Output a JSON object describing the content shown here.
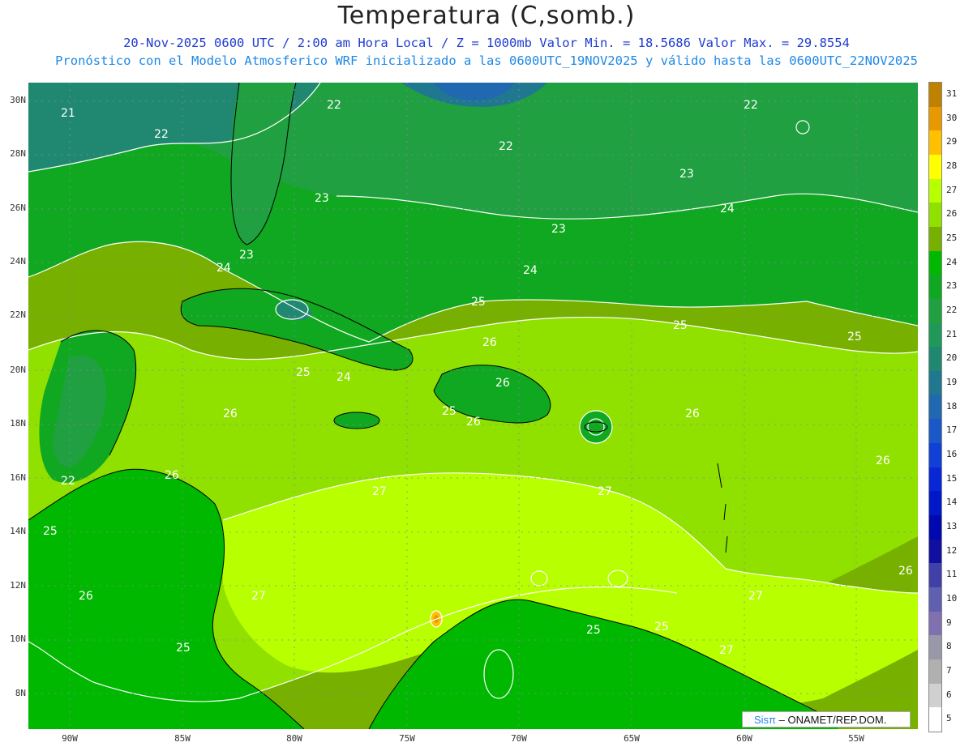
{
  "header": {
    "title": "Temperatura (C,somb.)",
    "line1": "20-Nov-2025  0600 UTC / 2:00 am Hora Local / Z = 1000mb   Valor Min. = 18.5686  Valor Max. = 29.8554",
    "line2": "Pronóstico con el Modelo Atmosferico WRF inicializado a las 0600UTC_19NOV2025 y válido hasta las  0600UTC_22NOV2025"
  },
  "axes": {
    "lat_labels": [
      "30N",
      "28N",
      "26N",
      "24N",
      "22N",
      "20N",
      "18N",
      "16N",
      "14N",
      "12N",
      "10N",
      "8N"
    ],
    "lon_labels": [
      "90W",
      "85W",
      "80W",
      "75W",
      "70W",
      "65W",
      "60W",
      "55W"
    ]
  },
  "contour_labels": [
    "21",
    "22",
    "22",
    "22",
    "22",
    "23",
    "23",
    "23",
    "23",
    "24",
    "24",
    "24",
    "24",
    "25",
    "25",
    "25",
    "25",
    "25",
    "25",
    "25",
    "25",
    "26",
    "26",
    "26",
    "26",
    "26",
    "26",
    "26",
    "26",
    "27",
    "27",
    "27",
    "27",
    "27",
    "22",
    "25",
    "26"
  ],
  "colorbar": {
    "labels": [
      "31",
      "30",
      "29",
      "28",
      "27",
      "26",
      "25",
      "24",
      "23",
      "22",
      "21",
      "20",
      "19",
      "18",
      "17",
      "16",
      "15",
      "14",
      "13",
      "12",
      "11",
      "10",
      "9",
      "8",
      "7",
      "6",
      "5"
    ],
    "colors": [
      "#c08000",
      "#e89800",
      "#ffc000",
      "#ffff00",
      "#b8ff00",
      "#90e000",
      "#78b000",
      "#00b800",
      "#10a820",
      "#20a040",
      "#209858",
      "#208870",
      "#207890",
      "#2068b0",
      "#1a58c8",
      "#1040d8",
      "#0828d8",
      "#0018c8",
      "#0008b0",
      "#1010a0",
      "#4040a8",
      "#6060b0",
      "#8070b0",
      "#9898a8",
      "#b0b0b0",
      "#d0d0d0",
      "#ffffff"
    ],
    "icon": "vertical-colorbar"
  },
  "credit": {
    "brand": "Sisπ",
    "text": "– ONAMET/REP.DOM."
  }
}
